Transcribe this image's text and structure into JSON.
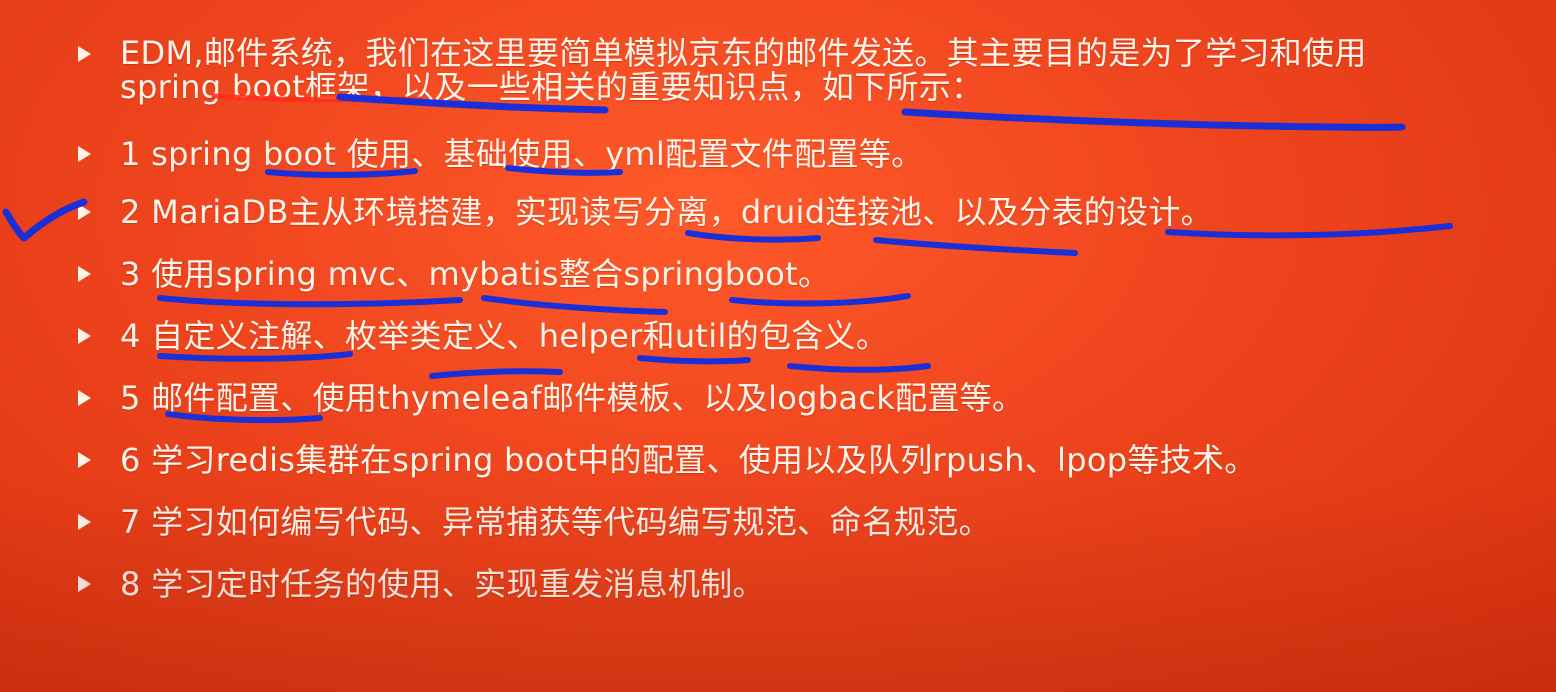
{
  "slide": {
    "items": [
      {
        "text": "EDM,邮件系统，我们在这里要简单模拟京东的邮件发送。其主要目的是为了学习和使用spring boot框架，以及一些相关的重要知识点，如下所示："
      },
      {
        "text": "1 spring boot 使用、基础使用、yml配置文件配置等。"
      },
      {
        "text": "2 MariaDB主从环境搭建，实现读写分离，druid连接池、以及分表的设计。"
      },
      {
        "text": "3 使用spring mvc、mybatis整合springboot。"
      },
      {
        "text": "4 自定义注解、枚举类定义、helper和util的包含义。"
      },
      {
        "text": "5 邮件配置、使用thymeleaf邮件模板、以及logback配置等。"
      },
      {
        "text": "6 学习redis集群在spring boot中的配置、使用以及队列rpush、lpop等技术。"
      },
      {
        "text": "7 学习如何编写代码、异常捕获等代码编写规范、命名规范。"
      },
      {
        "text": "8 学习定时任务的使用、实现重发消息机制。"
      }
    ]
  },
  "colors": {
    "background": "#e8411a",
    "text": "#fff3ea",
    "annotation_blue": "#1a2fd8",
    "annotation_red": "#ff2a1a"
  },
  "icons": {
    "bullet": "triangle-right-icon",
    "annotation": "checkmark-icon"
  }
}
